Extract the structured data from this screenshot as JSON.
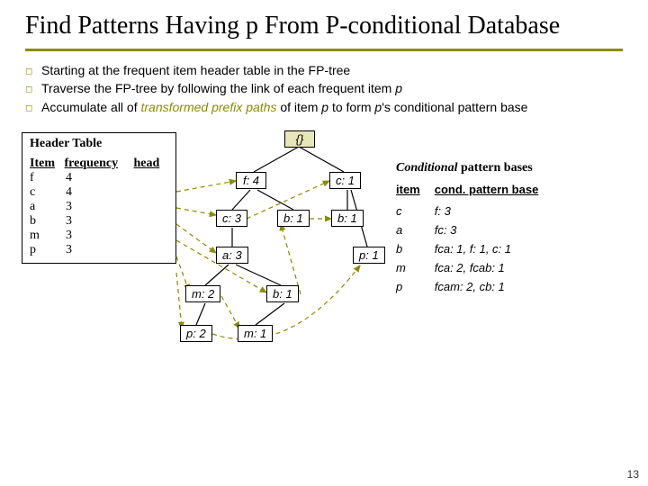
{
  "title": "Find Patterns Having p From P-conditional Database",
  "bullets": [
    {
      "plain": "Starting at the frequent item header table in the FP-tree"
    },
    {
      "plain": "Traverse the FP-tree by following the link of each frequent item ",
      "tail_i": "p"
    },
    {
      "pre": "Accumulate all of ",
      "olive": "transformed prefix paths",
      "mid": " of item ",
      "i1": "p",
      "mid2": " to form ",
      "i2": "p",
      "post": "'s conditional pattern base"
    }
  ],
  "header_table": {
    "title": "Header Table",
    "cols": [
      "Item",
      "frequency",
      "head"
    ],
    "rows": [
      {
        "item": "f",
        "freq": "4"
      },
      {
        "item": "c",
        "freq": "4"
      },
      {
        "item": "a",
        "freq": "3"
      },
      {
        "item": "b",
        "freq": "3"
      },
      {
        "item": "m",
        "freq": "3"
      },
      {
        "item": "p",
        "freq": "3"
      }
    ]
  },
  "tree": {
    "root": "{}",
    "n_f4": "f: 4",
    "n_c1": "c: 1",
    "n_c3": "c: 3",
    "n_b1a": "b: 1",
    "n_b1b": "b: 1",
    "n_a3": "a: 3",
    "n_p1": "p: 1",
    "n_m2": "m: 2",
    "n_b1c": "b: 1",
    "n_p2": "p: 2",
    "n_m1": "m: 1"
  },
  "cpb": {
    "title_strong": "Conditional",
    "title_rest": " pattern bases",
    "cols": [
      "item",
      "cond. pattern base"
    ],
    "rows": [
      {
        "item": "c",
        "base": "f: 3"
      },
      {
        "item": "a",
        "base": "fc: 3"
      },
      {
        "item": "b",
        "base": "fca: 1, f: 1, c: 1"
      },
      {
        "item": "m",
        "base": "fca: 2, fcab: 1"
      },
      {
        "item": "p",
        "base": "fcam: 2, cb: 1"
      }
    ]
  },
  "page_num": "13"
}
